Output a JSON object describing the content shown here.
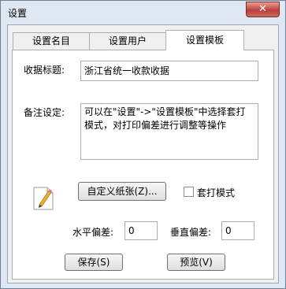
{
  "window": {
    "title": "设置",
    "close_label": "✕"
  },
  "tabs": [
    {
      "label": "设置名目",
      "active": false
    },
    {
      "label": "设置用户",
      "active": false
    },
    {
      "label": "设置模板",
      "active": true
    }
  ],
  "form": {
    "receipt_title_label": "收据标题:",
    "receipt_title_value": "浙江省统一收款收据",
    "remark_label": "备注设定:",
    "remark_value": "可以在\"设置\"->\"设置模板\"中选择套打模式，对打印偏差进行调整等操作",
    "custom_paper_button": "自定义纸张(Z)...",
    "overlay_mode_label": "套打模式",
    "overlay_mode_checked": false,
    "h_offset_label": "水平偏差:",
    "h_offset_value": "0",
    "v_offset_label": "垂直偏差:",
    "v_offset_value": "0",
    "save_button": "保存(S)",
    "preview_button": "预览(V)"
  },
  "icons": {
    "template_icon": "pencil-paper-icon",
    "close_icon": "close-icon"
  }
}
